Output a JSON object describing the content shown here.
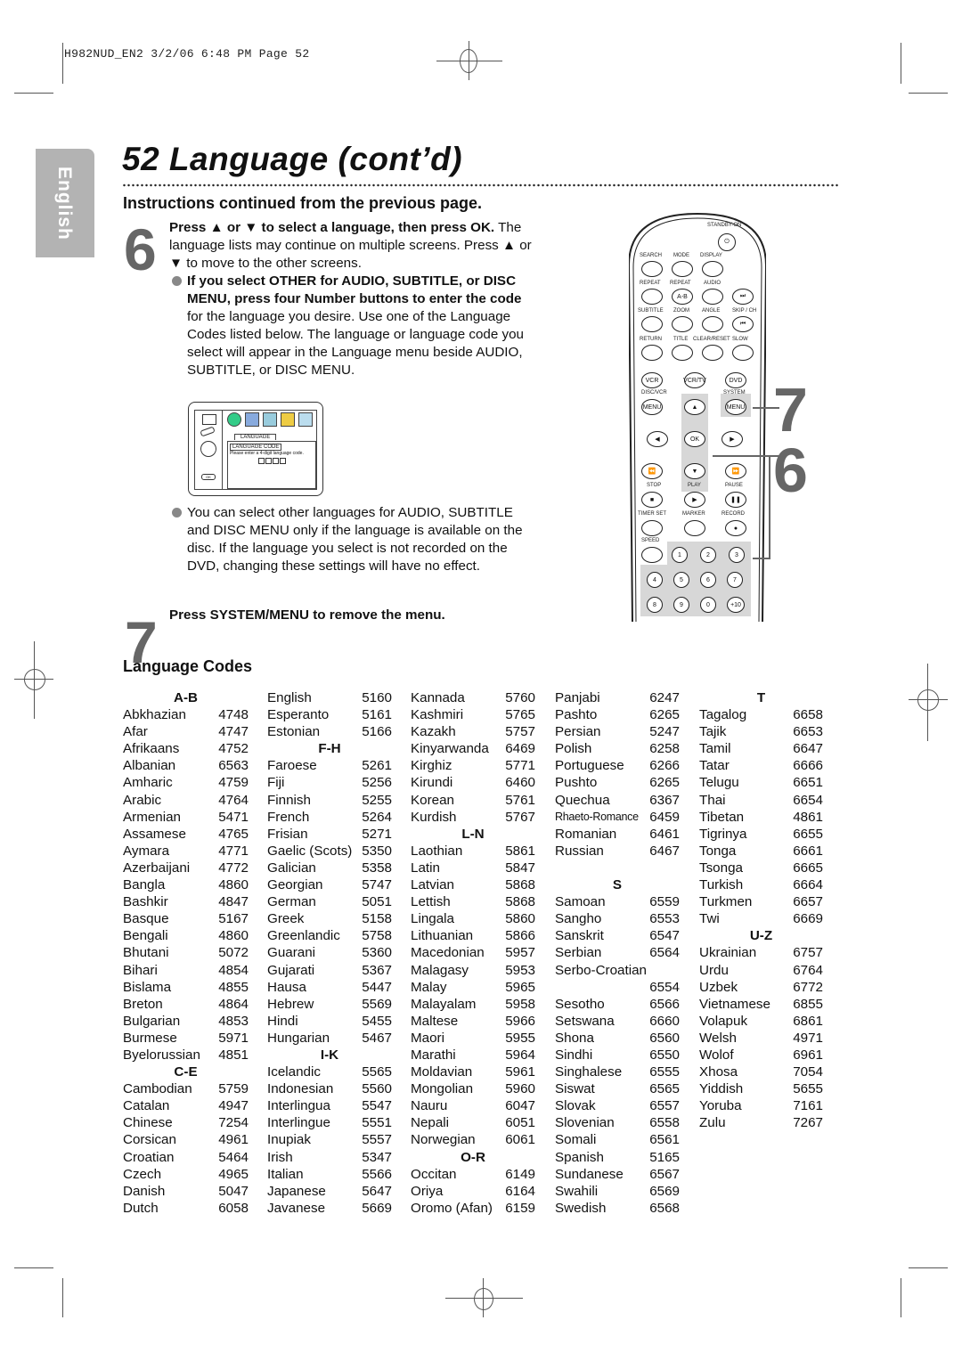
{
  "slug": "H982NUD_EN2  3/2/06  6:48 PM  Page 52",
  "side_tab": "English",
  "page": {
    "title": "52  Language (cont’d)",
    "subheading": "Instructions continued from the previous page."
  },
  "step6": {
    "number": "6",
    "lead_bold": "Press ▲ or ▼ to select a language, then press OK.",
    "lead_text": " The language lists may continue on multiple screens. Press ▲ or ▼ to move to the other screens.",
    "bullet1_bold": "If you select OTHER for AUDIO, SUBTITLE, or DISC MENU, press four Number buttons to enter the code",
    "bullet1_text": " for the language you desire. Use one of the Language Codes listed below. The language or language code you select will appear in the Language menu beside AUDIO, SUBTITLE, or DISC MENU.",
    "bullet2_text": "You can select other languages for AUDIO, SUBTITLE and DISC MENU only if the language is available on the disc. If the language you select is not recorded on the DVD, changing these settings will have no effect."
  },
  "osd": {
    "tab_label": "LANGUAGE",
    "field_label": "LANGUAGE CODE",
    "prompt": "Please enter a 4-digit language code.",
    "ok_label": "OK"
  },
  "step7": {
    "number": "7",
    "text": "Press SYSTEM/MENU to remove the menu."
  },
  "remote": {
    "callout_7": "7",
    "callout_6": "6",
    "labels": {
      "standby": "STANDBY-ON",
      "search": "SEARCH",
      "mode": "MODE",
      "display": "DISPLAY",
      "repeat1": "REPEAT",
      "repeat2": "REPEAT",
      "audio": "AUDIO",
      "ab": "A-B",
      "subtitle": "SUBTITLE",
      "zoom": "ZOOM",
      "angle": "ANGLE",
      "skipch": "SKIP / CH",
      "return": "RETURN",
      "title": "TITLE",
      "clear": "CLEAR/RESET",
      "slow": "SLOW",
      "vcr": "VCR",
      "vcrtv": "VCR/TV",
      "dvd": "DVD",
      "discvcr": "DISC/VCR",
      "system": "SYSTEM",
      "menu1": "MENU",
      "menu2": "MENU",
      "ok": "OK",
      "stop": "STOP",
      "play": "PLAY",
      "pause": "PAUSE",
      "timerset": "TIMER SET",
      "marker": "MARKER",
      "record": "RECORD",
      "speed": "SPEED",
      "digits": [
        "1",
        "2",
        "3",
        "4",
        "5",
        "6",
        "7",
        "8",
        "9",
        "0",
        "+10"
      ]
    }
  },
  "codes_heading": "Language Codes",
  "codes": {
    "col1": [
      {
        "h": "A-B"
      },
      {
        "n": "Abkhazian",
        "c": "4748"
      },
      {
        "n": "Afar",
        "c": "4747"
      },
      {
        "n": "Afrikaans",
        "c": "4752"
      },
      {
        "n": "Albanian",
        "c": "6563"
      },
      {
        "n": "Amharic",
        "c": "4759"
      },
      {
        "n": "Arabic",
        "c": "4764"
      },
      {
        "n": "Armenian",
        "c": "5471"
      },
      {
        "n": "Assamese",
        "c": "4765"
      },
      {
        "n": "Aymara",
        "c": "4771"
      },
      {
        "n": "Azerbaijani",
        "c": "4772"
      },
      {
        "n": "Bangla",
        "c": "4860"
      },
      {
        "n": "Bashkir",
        "c": "4847"
      },
      {
        "n": "Basque",
        "c": "5167"
      },
      {
        "n": "Bengali",
        "c": "4860"
      },
      {
        "n": "Bhutani",
        "c": "5072"
      },
      {
        "n": "Bihari",
        "c": "4854"
      },
      {
        "n": "Bislama",
        "c": "4855"
      },
      {
        "n": "Breton",
        "c": "4864"
      },
      {
        "n": "Bulgarian",
        "c": "4853"
      },
      {
        "n": "Burmese",
        "c": "5971"
      },
      {
        "n": "Byelorussian",
        "c": "4851"
      },
      {
        "h": "C-E"
      },
      {
        "n": "Cambodian",
        "c": "5759"
      },
      {
        "n": "Catalan",
        "c": "4947"
      },
      {
        "n": "Chinese",
        "c": "7254"
      },
      {
        "n": "Corsican",
        "c": "4961"
      },
      {
        "n": "Croatian",
        "c": "5464"
      },
      {
        "n": "Czech",
        "c": "4965"
      },
      {
        "n": "Danish",
        "c": "5047"
      },
      {
        "n": "Dutch",
        "c": "6058"
      }
    ],
    "col2": [
      {
        "n": "English",
        "c": "5160"
      },
      {
        "n": "Esperanto",
        "c": "5161"
      },
      {
        "n": "Estonian",
        "c": "5166"
      },
      {
        "h": "F-H"
      },
      {
        "n": "Faroese",
        "c": "5261"
      },
      {
        "n": "Fiji",
        "c": "5256"
      },
      {
        "n": "Finnish",
        "c": "5255"
      },
      {
        "n": "French",
        "c": "5264"
      },
      {
        "n": "Frisian",
        "c": "5271"
      },
      {
        "n": "Gaelic (Scots)",
        "c": "5350"
      },
      {
        "n": "Galician",
        "c": "5358"
      },
      {
        "n": "Georgian",
        "c": "5747"
      },
      {
        "n": "German",
        "c": "5051"
      },
      {
        "n": "Greek",
        "c": "5158"
      },
      {
        "n": "Greenlandic",
        "c": "5758"
      },
      {
        "n": "Guarani",
        "c": "5360"
      },
      {
        "n": "Gujarati",
        "c": "5367"
      },
      {
        "n": "Hausa",
        "c": "5447"
      },
      {
        "n": "Hebrew",
        "c": "5569"
      },
      {
        "n": "Hindi",
        "c": "5455"
      },
      {
        "n": "Hungarian",
        "c": "5467"
      },
      {
        "h": "I-K"
      },
      {
        "n": "Icelandic",
        "c": "5565"
      },
      {
        "n": "Indonesian",
        "c": "5560"
      },
      {
        "n": "Interlingua",
        "c": "5547"
      },
      {
        "n": "Interlingue",
        "c": "5551"
      },
      {
        "n": "Inupiak",
        "c": "5557"
      },
      {
        "n": "Irish",
        "c": "5347"
      },
      {
        "n": "Italian",
        "c": "5566"
      },
      {
        "n": "Japanese",
        "c": "5647"
      },
      {
        "n": "Javanese",
        "c": "5669"
      }
    ],
    "col3": [
      {
        "n": "Kannada",
        "c": "5760"
      },
      {
        "n": "Kashmiri",
        "c": "5765"
      },
      {
        "n": "Kazakh",
        "c": "5757"
      },
      {
        "n": "Kinyarwanda",
        "c": "6469"
      },
      {
        "n": "Kirghiz",
        "c": "5771"
      },
      {
        "n": "Kirundi",
        "c": "6460"
      },
      {
        "n": "Korean",
        "c": "5761"
      },
      {
        "n": "Kurdish",
        "c": "5767"
      },
      {
        "h": "L-N"
      },
      {
        "n": "Laothian",
        "c": "5861"
      },
      {
        "n": "Latin",
        "c": "5847"
      },
      {
        "n": "Latvian",
        "c": "5868"
      },
      {
        "n": "Lettish",
        "c": "5868"
      },
      {
        "n": "Lingala",
        "c": "5860"
      },
      {
        "n": "Lithuanian",
        "c": "5866"
      },
      {
        "n": "Macedonian",
        "c": "5957"
      },
      {
        "n": "Malagasy",
        "c": "5953"
      },
      {
        "n": "Malay",
        "c": "5965"
      },
      {
        "n": "Malayalam",
        "c": "5958"
      },
      {
        "n": "Maltese",
        "c": "5966"
      },
      {
        "n": "Maori",
        "c": "5955"
      },
      {
        "n": "Marathi",
        "c": "5964"
      },
      {
        "n": "Moldavian",
        "c": "5961"
      },
      {
        "n": "Mongolian",
        "c": "5960"
      },
      {
        "n": "Nauru",
        "c": "6047"
      },
      {
        "n": "Nepali",
        "c": "6051"
      },
      {
        "n": "Norwegian",
        "c": "6061"
      },
      {
        "h": "O-R"
      },
      {
        "n": "Occitan",
        "c": "6149"
      },
      {
        "n": "Oriya",
        "c": "6164"
      },
      {
        "n": "Oromo (Afan)",
        "c": "6159"
      }
    ],
    "col4": [
      {
        "n": "Panjabi",
        "c": "6247"
      },
      {
        "n": "Pashto",
        "c": "6265"
      },
      {
        "n": "Persian",
        "c": "5247"
      },
      {
        "n": "Polish",
        "c": "6258"
      },
      {
        "n": "Portuguese",
        "c": "6266"
      },
      {
        "n": "Pushto",
        "c": "6265"
      },
      {
        "n": "Quechua",
        "c": "6367"
      },
      {
        "n": "Rhaeto-Romance",
        "c": "6459",
        "small": true
      },
      {
        "n": "Romanian",
        "c": "6461"
      },
      {
        "n": "Russian",
        "c": "6467"
      },
      {
        "blank": true
      },
      {
        "h": "S"
      },
      {
        "n": "Samoan",
        "c": "6559"
      },
      {
        "n": "Sangho",
        "c": "6553"
      },
      {
        "n": "Sanskrit",
        "c": "6547"
      },
      {
        "n": "Serbian",
        "c": "6564"
      },
      {
        "n": "Serbo-Croatian",
        "c": ""
      },
      {
        "n": "",
        "c": "6554"
      },
      {
        "n": "Sesotho",
        "c": "6566"
      },
      {
        "n": "Setswana",
        "c": "6660"
      },
      {
        "n": "Shona",
        "c": "6560"
      },
      {
        "n": "Sindhi",
        "c": "6550"
      },
      {
        "n": "Singhalese",
        "c": "6555"
      },
      {
        "n": "Siswat",
        "c": "6565"
      },
      {
        "n": "Slovak",
        "c": "6557"
      },
      {
        "n": "Slovenian",
        "c": "6558"
      },
      {
        "n": "Somali",
        "c": "6561"
      },
      {
        "n": "Spanish",
        "c": "5165"
      },
      {
        "n": "Sundanese",
        "c": "6567"
      },
      {
        "n": "Swahili",
        "c": "6569"
      },
      {
        "n": "Swedish",
        "c": "6568"
      }
    ],
    "col5": [
      {
        "h": "T"
      },
      {
        "n": "Tagalog",
        "c": "6658"
      },
      {
        "n": "Tajik",
        "c": "6653"
      },
      {
        "n": "Tamil",
        "c": "6647"
      },
      {
        "n": "Tatar",
        "c": "6666"
      },
      {
        "n": "Telugu",
        "c": "6651"
      },
      {
        "n": "Thai",
        "c": "6654"
      },
      {
        "n": "Tibetan",
        "c": "4861"
      },
      {
        "n": "Tigrinya",
        "c": "6655"
      },
      {
        "n": "Tonga",
        "c": "6661"
      },
      {
        "n": "Tsonga",
        "c": "6665"
      },
      {
        "n": "Turkish",
        "c": "6664"
      },
      {
        "n": "Turkmen",
        "c": "6657"
      },
      {
        "n": "Twi",
        "c": "6669"
      },
      {
        "h": "U-Z"
      },
      {
        "n": "Ukrainian",
        "c": "6757"
      },
      {
        "n": "Urdu",
        "c": "6764"
      },
      {
        "n": "Uzbek",
        "c": "6772"
      },
      {
        "n": "Vietnamese",
        "c": "6855"
      },
      {
        "n": "Volapuk",
        "c": "6861"
      },
      {
        "n": "Welsh",
        "c": "4971"
      },
      {
        "n": "Wolof",
        "c": "6961"
      },
      {
        "n": "Xhosa",
        "c": "7054"
      },
      {
        "n": "Yiddish",
        "c": "5655"
      },
      {
        "n": "Yoruba",
        "c": "7161"
      },
      {
        "n": "Zulu",
        "c": "7267"
      }
    ]
  }
}
